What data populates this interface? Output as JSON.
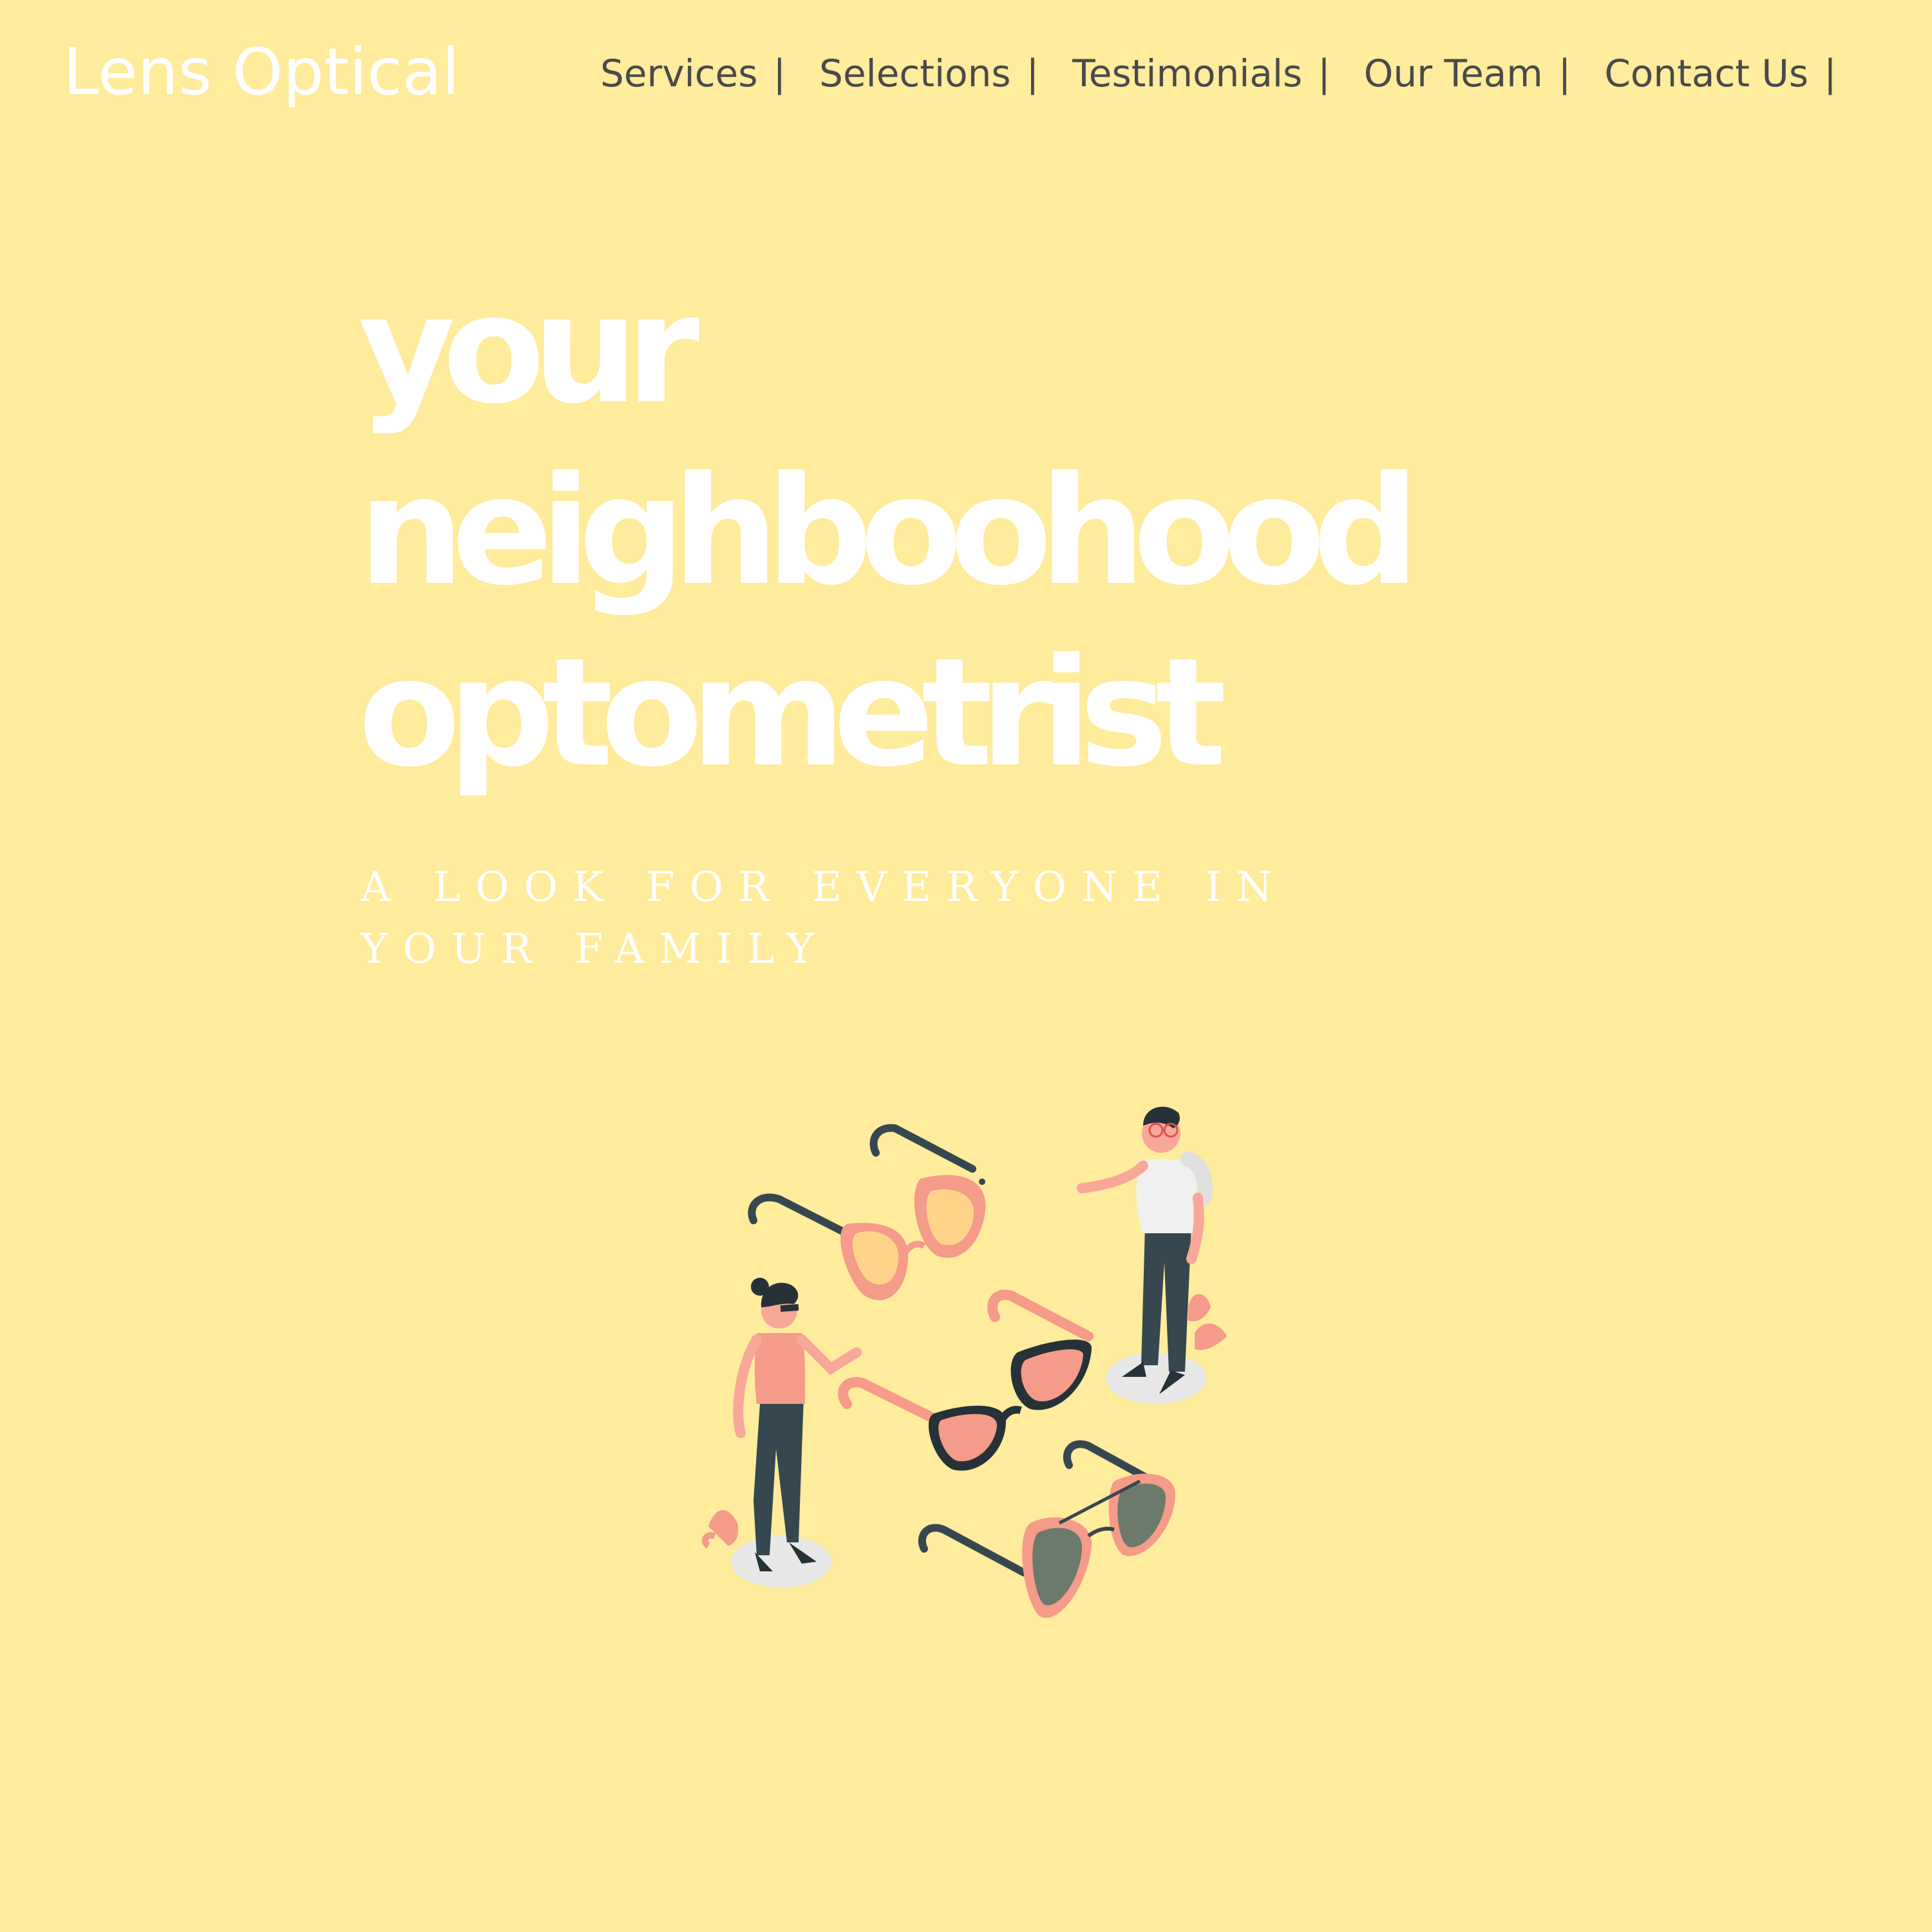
{
  "brand": {
    "name": "Lens Optical"
  },
  "nav": {
    "items": [
      {
        "label": "Services",
        "separator": "|"
      },
      {
        "label": "Selections",
        "separator": "|"
      },
      {
        "label": "Testimonials",
        "separator": "|"
      },
      {
        "label": "Our Team",
        "separator": "|"
      },
      {
        "label": "Contact Us",
        "separator": "|"
      }
    ]
  },
  "hero": {
    "title_lines": [
      "your",
      "neighboohood",
      "optometrist"
    ],
    "subtitle": "A LOOK FOR EVERYONE IN YOUR FAMILY"
  },
  "illustration": {
    "icon": "glasses-people-illustration"
  },
  "colors": {
    "background": "#FFEC9C",
    "hero_text": "#FFFFFF",
    "nav_text": "#4A4A4A",
    "accent_pink": "#F59B8A",
    "dark": "#37474F"
  }
}
